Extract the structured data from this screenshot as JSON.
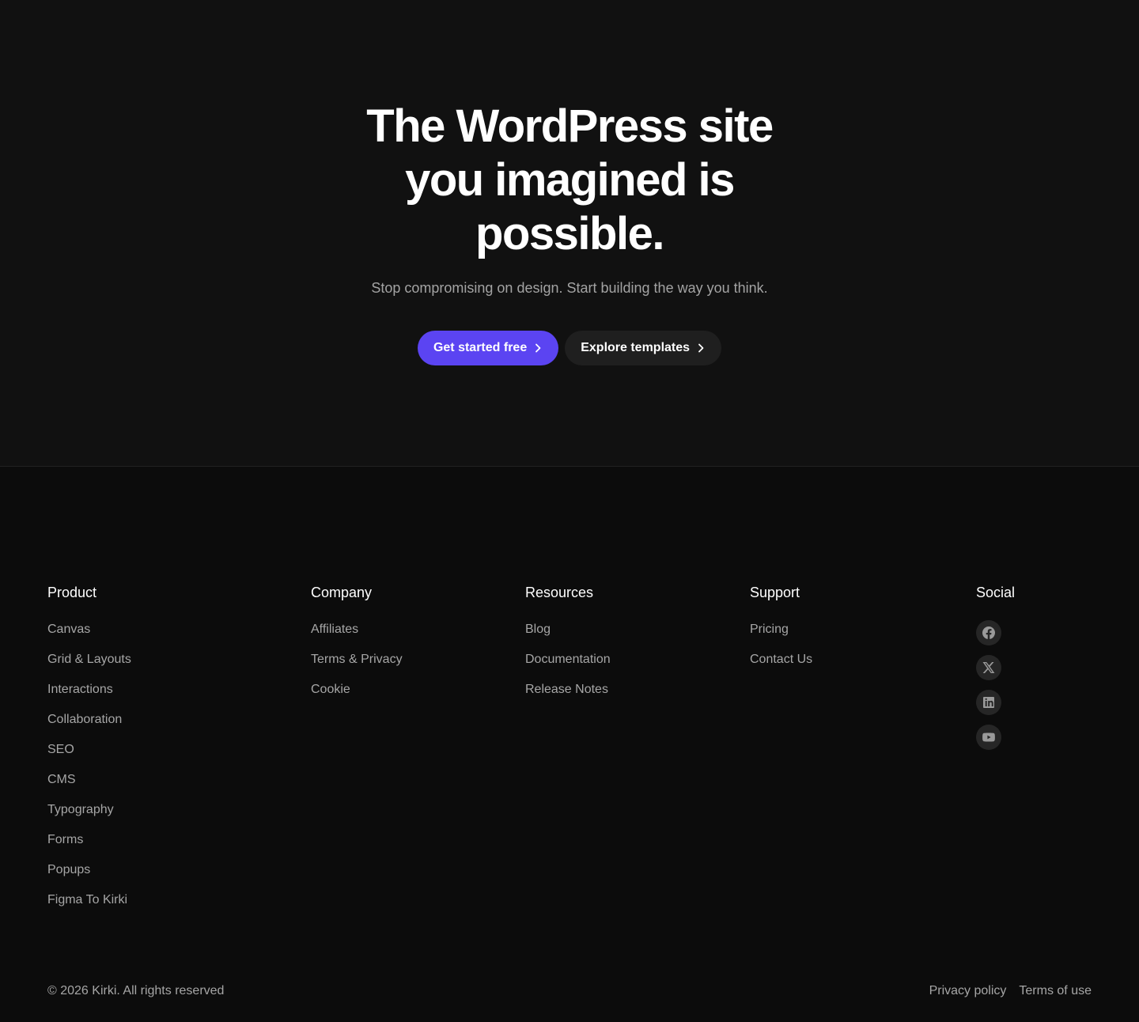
{
  "hero": {
    "title_lines": [
      "The WordPress site",
      "you imagined is",
      "possible."
    ],
    "subtitle": "Stop compromising on design. Start building the way you think.",
    "primary_label": "Get started free",
    "secondary_label": "Explore templates"
  },
  "footer": {
    "columns": [
      {
        "heading": "Product",
        "links": [
          "Canvas",
          "Grid & Layouts",
          "Interactions",
          "Collaboration",
          "SEO",
          "CMS",
          "Typography",
          "Forms",
          "Popups",
          "Figma To Kirki"
        ]
      },
      {
        "heading": "Company",
        "links": [
          "Affiliates",
          "Terms & Privacy",
          "Cookie"
        ]
      },
      {
        "heading": "Resources",
        "links": [
          "Blog",
          "Documentation",
          "Release Notes"
        ]
      },
      {
        "heading": "Support",
        "links": [
          "Pricing",
          "Contact Us"
        ]
      }
    ],
    "social": {
      "heading": "Social",
      "icons": [
        "facebook-icon",
        "x-icon",
        "linkedin-icon",
        "youtube-icon"
      ]
    },
    "copyright": "© 2026 Kirki. All rights reserved",
    "privacy_label": "Privacy policy",
    "terms_label": "Terms of use"
  },
  "colors": {
    "background": "#0c0c0c",
    "hero_background": "#111111",
    "primary": "#5b44f2",
    "secondary_button": "#1f1f1f",
    "muted_text": "#a6a6a6"
  }
}
